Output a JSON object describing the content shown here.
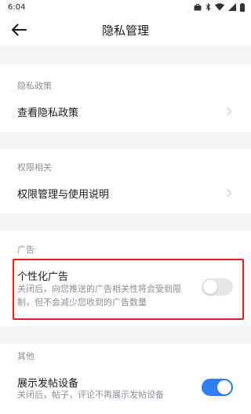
{
  "status_bar": {
    "time": "6:04"
  },
  "header": {
    "title": "隐私管理"
  },
  "sections": {
    "privacy_policy": {
      "title": "隐私政策",
      "item": "查看隐私政策"
    },
    "permissions": {
      "title": "权限相关",
      "item": "权限管理与使用说明"
    },
    "ads": {
      "title": "广告",
      "item": "个性化广告",
      "desc_line1": "关闭后，向您推送的广告相关性将会受到限",
      "desc_line2": "制，但不会减少您收到的广告数量",
      "toggle_on": false
    },
    "other": {
      "title": "其他",
      "item": "展示发帖设备",
      "desc": "关闭后，帖子，评论不再展示发帖设备",
      "toggle_on": true
    }
  },
  "colors": {
    "accent": "#2f7ff6",
    "toggle_off": "#e6e6e6",
    "highlight": "#e0241d"
  }
}
